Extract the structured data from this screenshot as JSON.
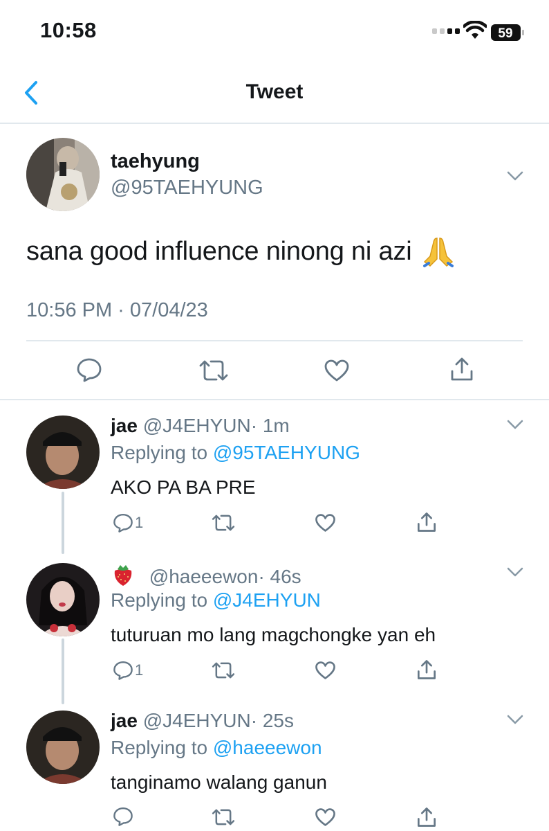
{
  "status_bar": {
    "time": "10:58",
    "battery": "59"
  },
  "nav": {
    "title": "Tweet"
  },
  "tweet": {
    "display_name": "taehyung",
    "handle": "@95TAEHYUNG",
    "text": "sana good influence ninong ni azi",
    "emoji": "pray",
    "timestamp": "10:56 PM · 07/04/23"
  },
  "replies": [
    {
      "display_name": "jae",
      "handle": "@J4EHYUN",
      "time": "· 1m",
      "replying_label": "Replying to",
      "replying_to": "@95TAEHYUNG",
      "text": "AKO PA BA PRE",
      "reply_count": "1"
    },
    {
      "display_name_emoji": "strawberry",
      "handle": "@haeeewon",
      "time": "· 46s",
      "replying_label": "Replying to",
      "replying_to": "@J4EHYUN",
      "text": "tuturuan mo lang magchongke yan eh",
      "reply_count": "1"
    },
    {
      "display_name": "jae",
      "handle": "@J4EHYUN",
      "time": "· 25s",
      "replying_label": "Replying to",
      "replying_to": "@haeeewon",
      "text": "tanginamo walang ganun",
      "reply_count": ""
    }
  ],
  "colors": {
    "accent": "#1da1f2",
    "secondary_text": "#657786",
    "divider": "#e1e8ed",
    "thread_line": "#ccd6dd"
  }
}
